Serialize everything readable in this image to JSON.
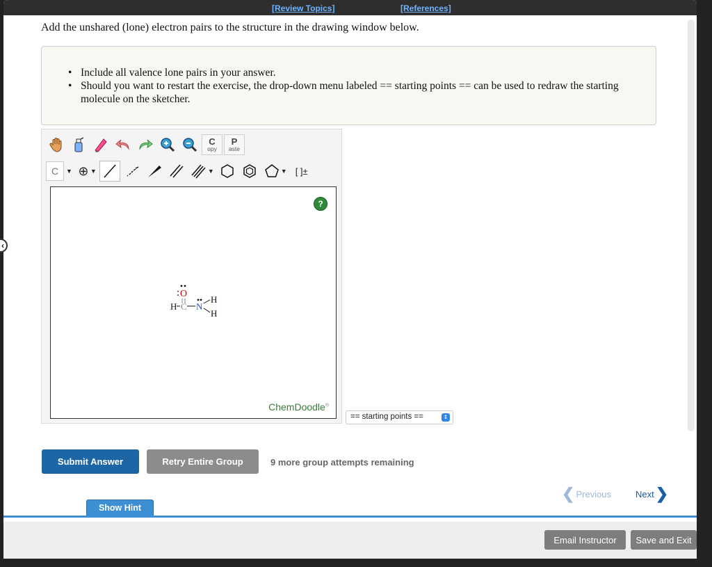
{
  "topbar": {
    "review_topics": "[Review Topics]",
    "references": "[References]"
  },
  "question": {
    "instruction": "Add the unshared (lone) electron pairs to the structure in the drawing window below.",
    "bullets": [
      "Include all valence lone pairs in your answer.",
      "Should you want to restart the exercise, the drop-down menu labeled == starting points == can be used to redraw the starting molecule on the sketcher."
    ]
  },
  "sketcher": {
    "toolbar1": [
      "hand-icon",
      "eraser-bottle-icon",
      "pencil-eraser-icon",
      "undo-icon",
      "redo-icon",
      "zoom-in-icon",
      "zoom-out-icon"
    ],
    "copy_big": "C",
    "copy_small": "opy",
    "paste_big": "P",
    "paste_small": "aste",
    "element_label": "C",
    "charge_label": "⊕",
    "bracket_label": "[ ]±",
    "help_label": "?",
    "brand": "ChemDoodle",
    "brand_mark": "®",
    "molecule": {
      "o": "O",
      "h1": "H",
      "c": "C",
      "n": "N",
      "h2": "H",
      "h3": "H"
    }
  },
  "starting_points": {
    "selected": "== starting points =="
  },
  "actions": {
    "submit": "Submit Answer",
    "retry": "Retry Entire Group",
    "attempts": "9 more group attempts remaining",
    "previous": "Previous",
    "next": "Next",
    "hint": "Show Hint"
  },
  "footer": {
    "email": "Email Instructor",
    "save": "Save and Exit"
  },
  "colors": {
    "accent": "#1d66a5",
    "link": "#6fb3ff",
    "oxygen": "#d00000",
    "nitrogen": "#1f4fd6",
    "brand": "#3a7d3a"
  }
}
